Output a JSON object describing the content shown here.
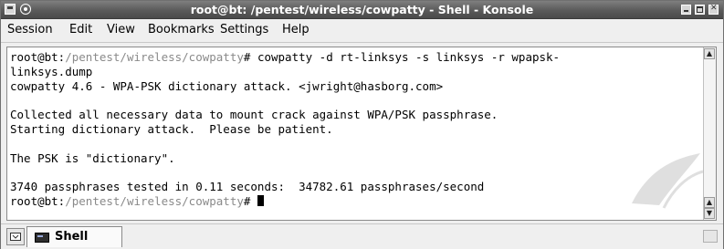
{
  "window": {
    "title": "root@bt: /pentest/wireless/cowpatty - Shell - Konsole"
  },
  "menu": {
    "items": [
      "Session",
      "Edit",
      "View",
      "Bookmarks",
      "Settings",
      "Help"
    ]
  },
  "terminal": {
    "prompt_user": "root@bt:",
    "prompt_path": "/pentest/wireless/cowpatty",
    "prompt_symbol": "# ",
    "command": "cowpatty -d rt-linksys -s linksys -r wpapsk-",
    "command_wrap": "linksys.dump",
    "output": [
      "cowpatty 4.6 - WPA-PSK dictionary attack. <jwright@hasborg.com>",
      "",
      "Collected all necessary data to mount crack against WPA/PSK passphrase.",
      "Starting dictionary attack.  Please be patient.",
      "",
      "The PSK is \"dictionary\".",
      "",
      "3740 passphrases tested in 0.11 seconds:  34782.61 passphrases/second"
    ]
  },
  "tabs": [
    {
      "label": "Shell",
      "icon": "terminal-icon"
    }
  ]
}
